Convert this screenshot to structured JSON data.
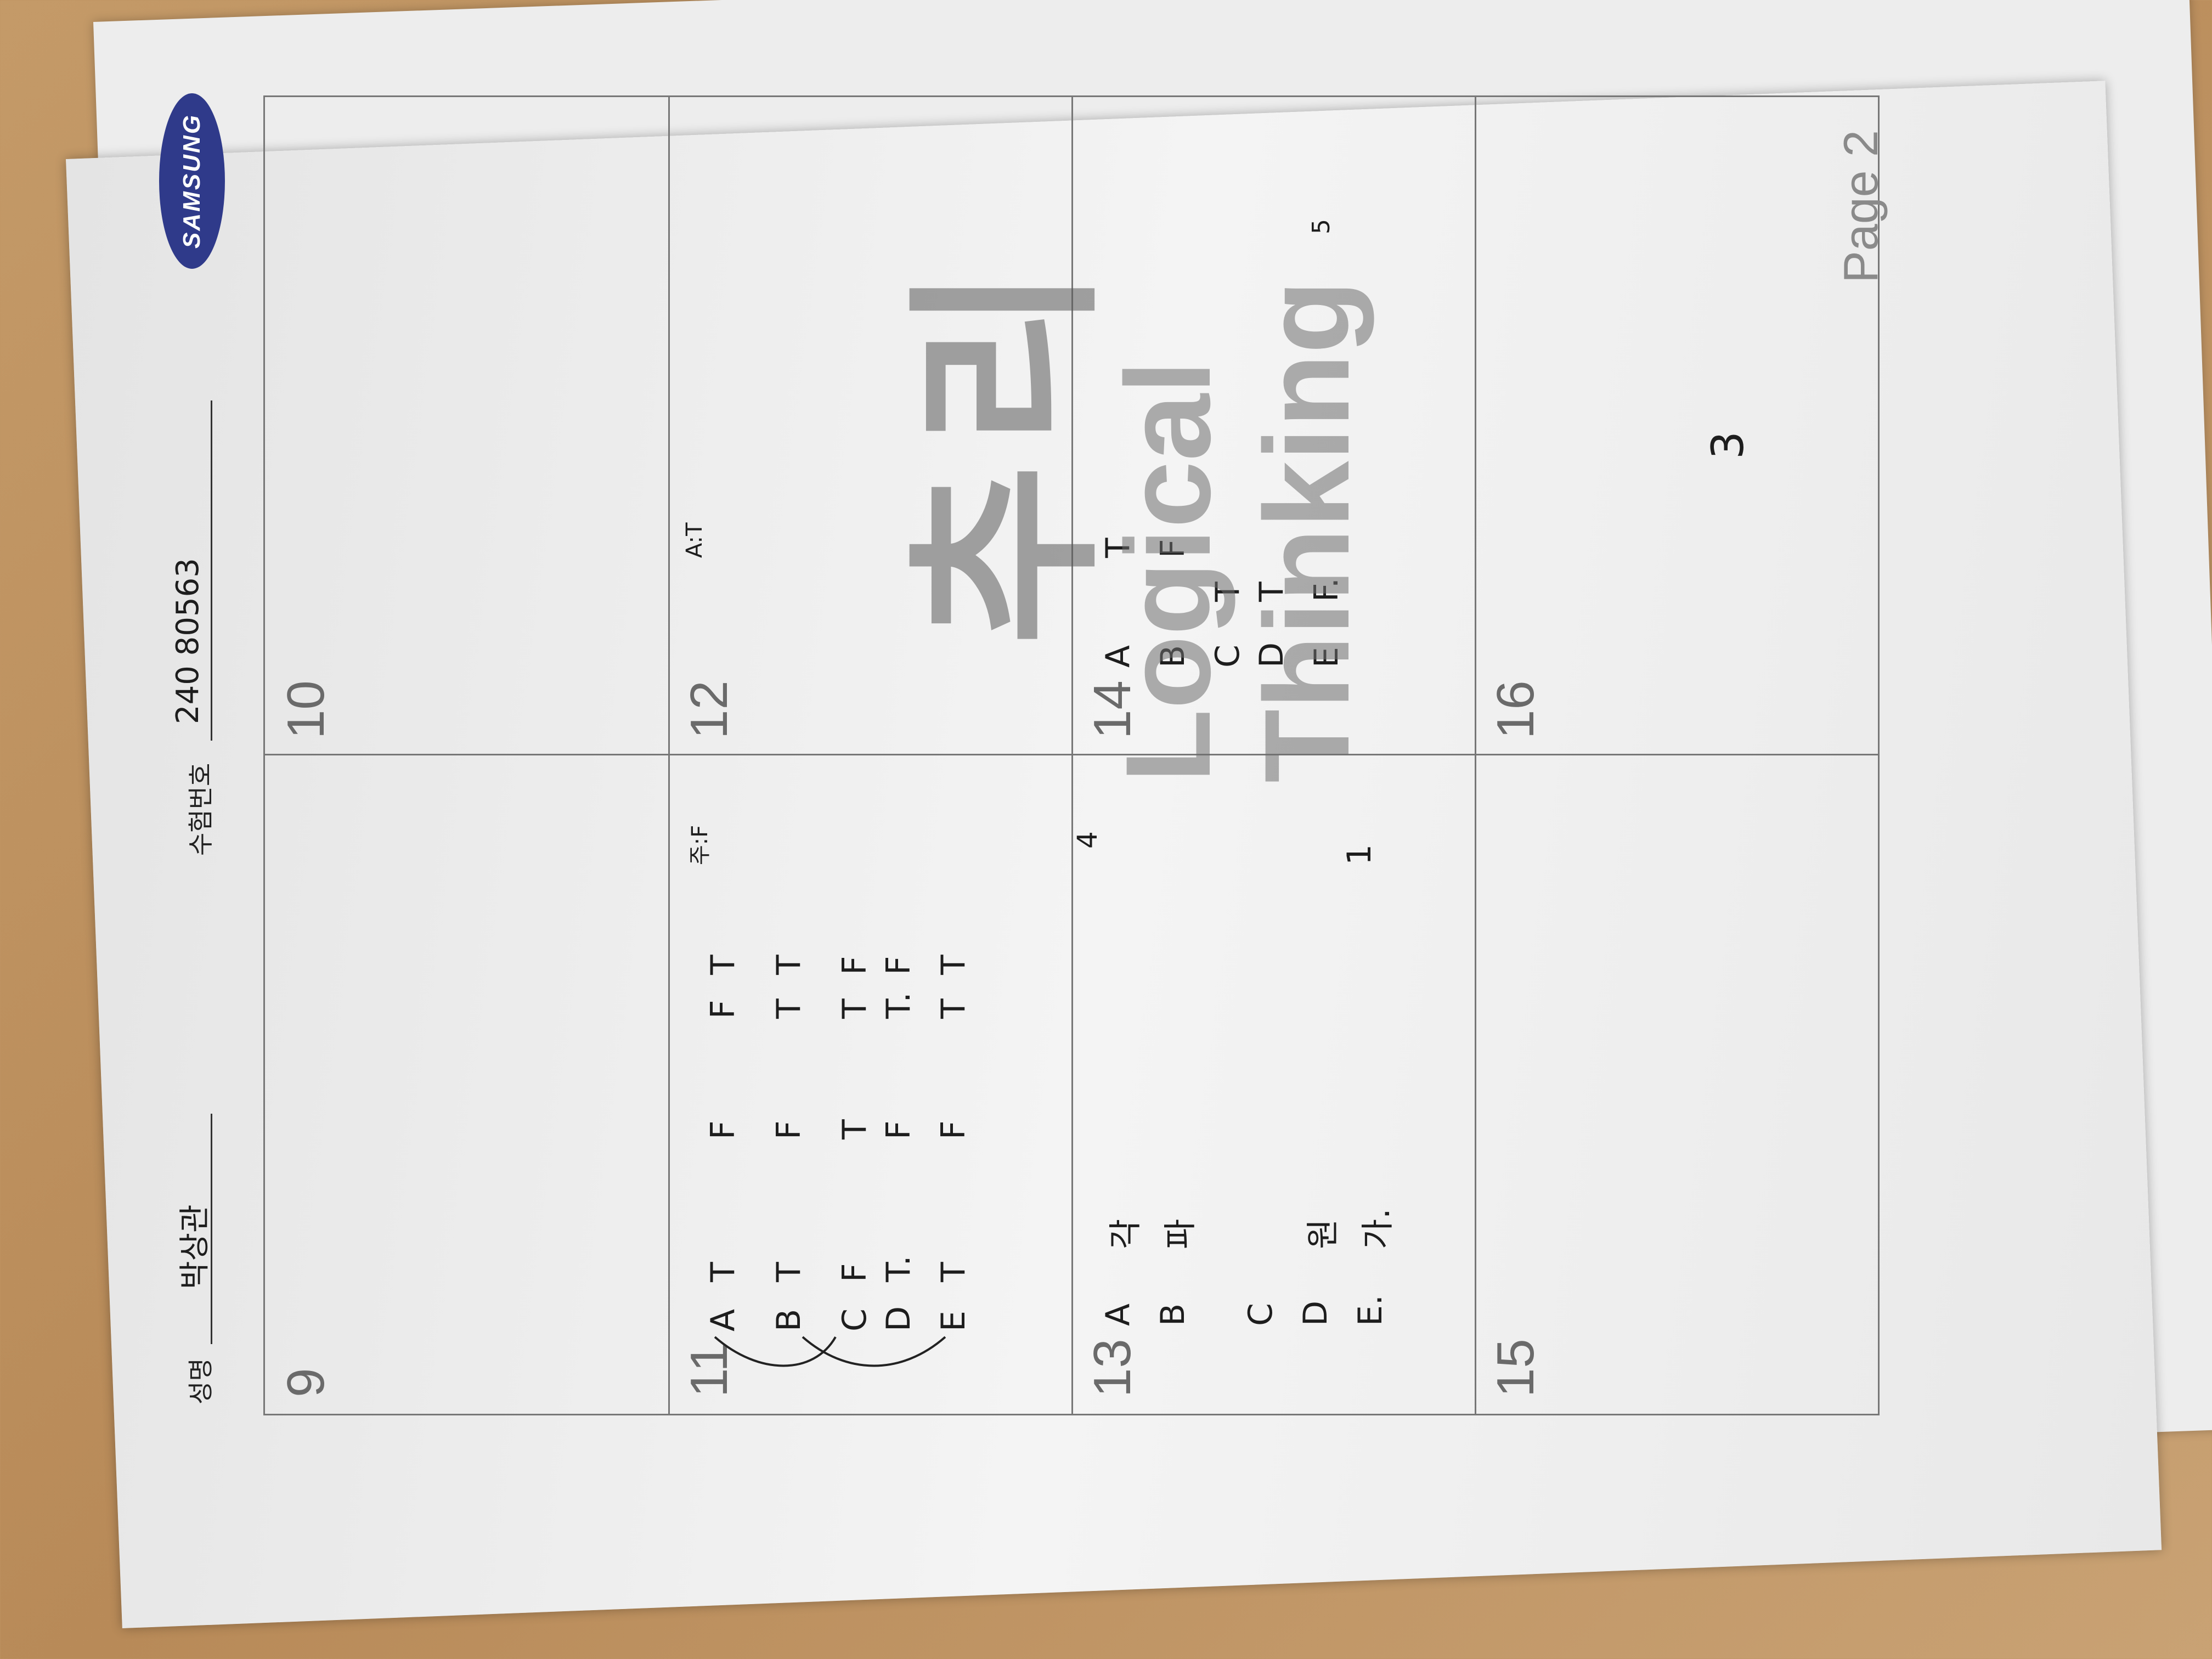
{
  "header": {
    "name_label": "성명",
    "name_value": "박상관",
    "id_label": "수험번호",
    "id_value": "240 80563",
    "logo_text": "SAMSUNG"
  },
  "questions": [
    "9",
    "10",
    "11",
    "12",
    "13",
    "14",
    "15",
    "16"
  ],
  "watermark": {
    "korean": "추리",
    "english": "Logical Thinking"
  },
  "answers": {
    "q11": {
      "rows": [
        [
          "A",
          "T",
          "F",
          "F",
          "T"
        ],
        [
          "B",
          "T",
          "F",
          "T",
          "T"
        ],
        [
          "C",
          "F",
          "T",
          "T",
          "F"
        ],
        [
          "D",
          "T.",
          "F",
          "T.",
          "F"
        ],
        [
          "E",
          "T",
          "F",
          "T",
          "T"
        ]
      ],
      "notes": [
        "주:F",
        "A:T"
      ]
    },
    "q13": {
      "rows": [
        [
          "A",
          "각"
        ],
        [
          "B",
          "파"
        ],
        [
          "C",
          ""
        ],
        [
          "D",
          "원"
        ],
        [
          "E.",
          "가."
        ]
      ],
      "answer": "1"
    },
    "q14": {
      "rows": [
        [
          "A",
          "T"
        ],
        [
          "B",
          "F"
        ],
        [
          "C",
          "T"
        ],
        [
          "D",
          "T"
        ],
        [
          "E",
          "F."
        ]
      ],
      "answer": "5"
    },
    "q16": {
      "answer": "3"
    },
    "q_mid": {
      "answer": "4"
    }
  },
  "footer": {
    "page": "Page 2"
  }
}
